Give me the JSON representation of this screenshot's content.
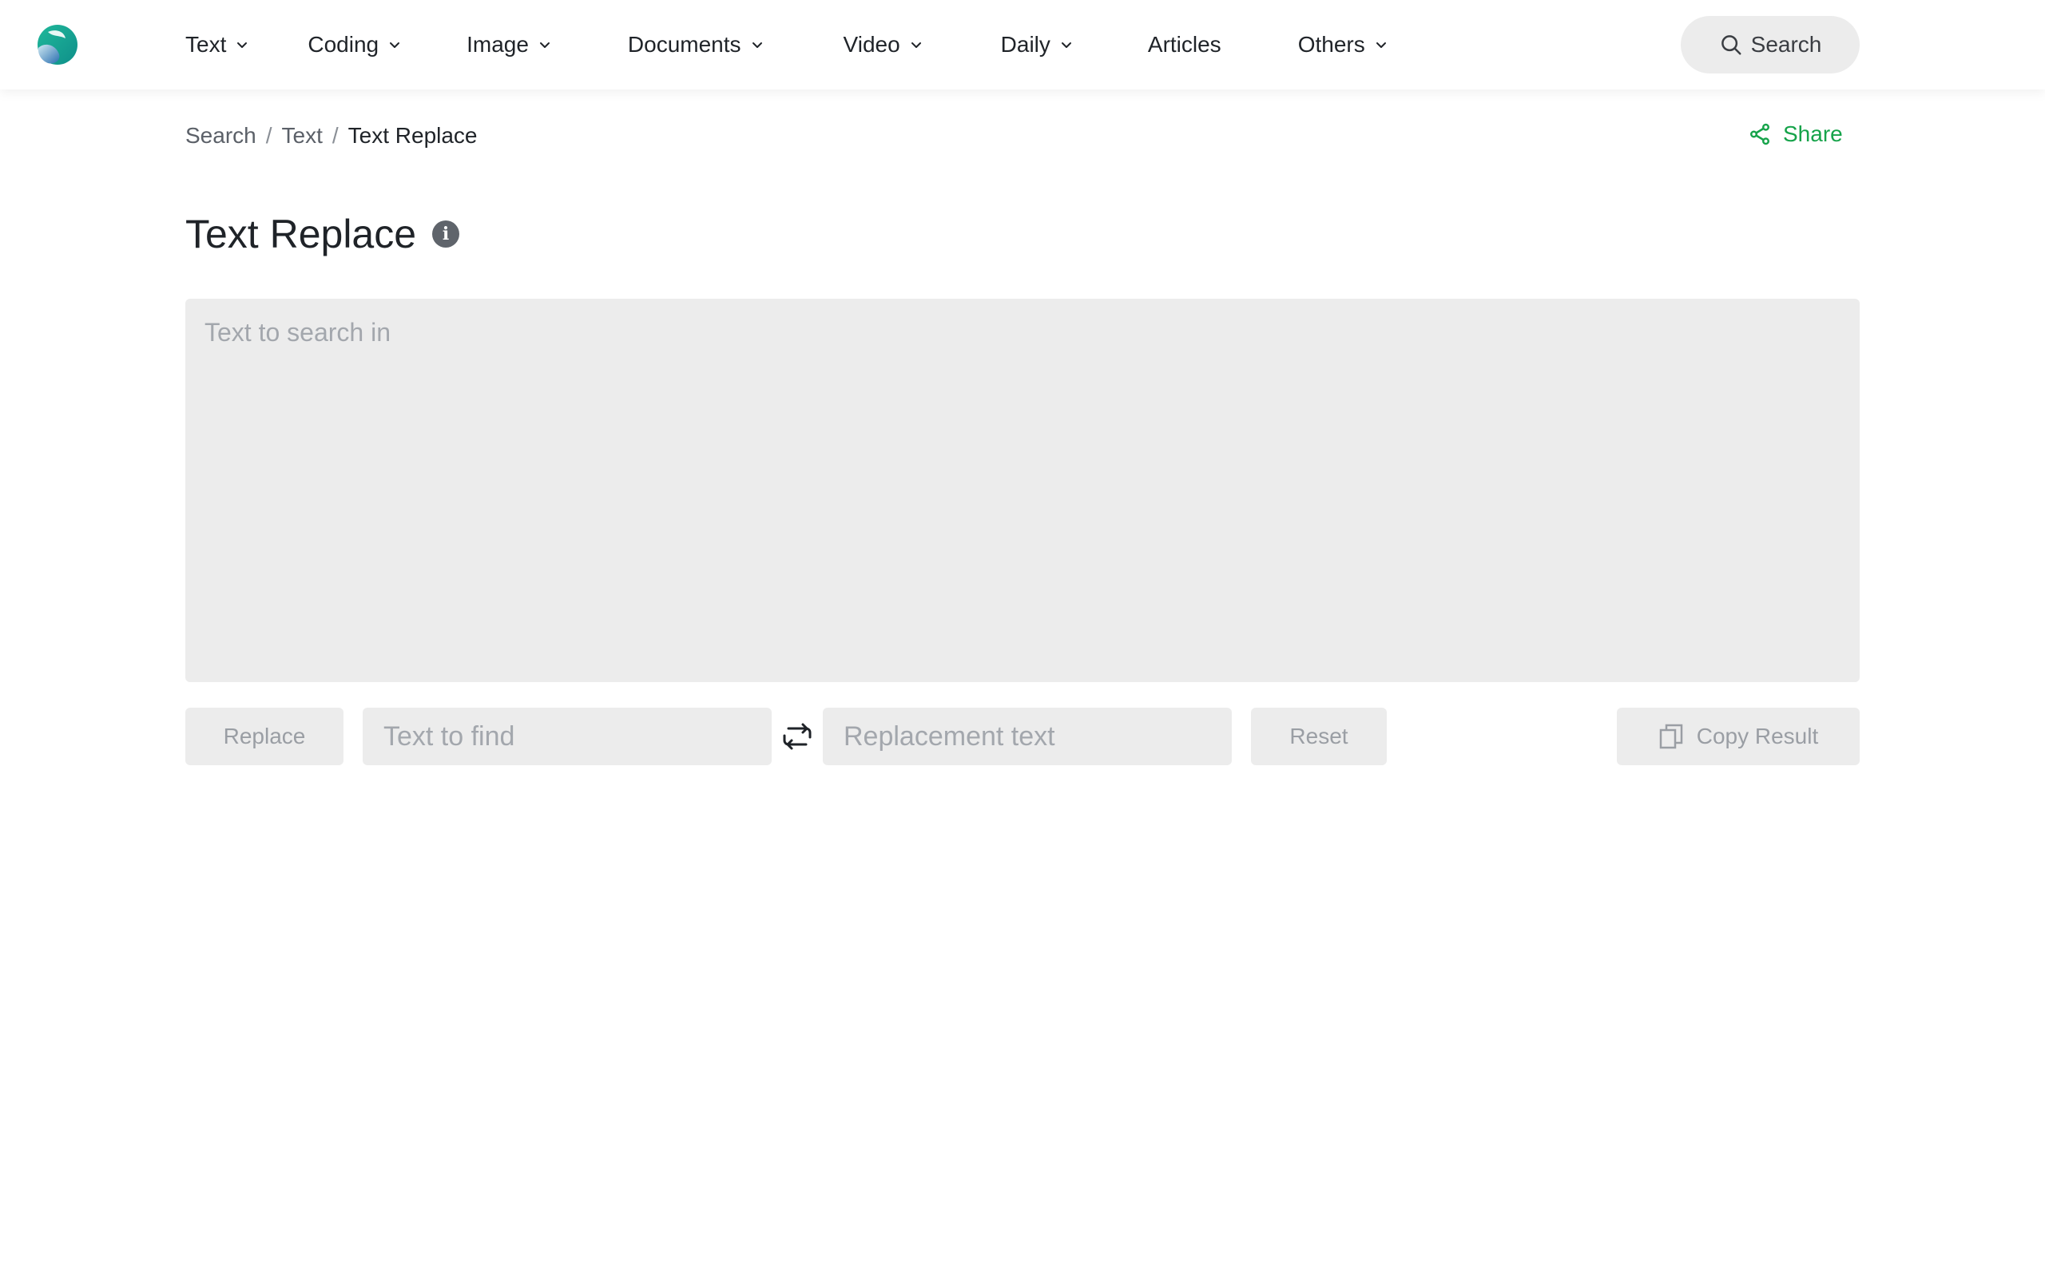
{
  "nav": {
    "items": [
      {
        "label": "Text",
        "has_dropdown": true,
        "active": true
      },
      {
        "label": "Coding",
        "has_dropdown": true,
        "active": false
      },
      {
        "label": "Image",
        "has_dropdown": true,
        "active": false
      },
      {
        "label": "Documents",
        "has_dropdown": true,
        "active": false
      },
      {
        "label": "Video",
        "has_dropdown": true,
        "active": false
      },
      {
        "label": "Daily",
        "has_dropdown": true,
        "active": false
      },
      {
        "label": "Articles",
        "has_dropdown": false,
        "active": false
      },
      {
        "label": "Others",
        "has_dropdown": true,
        "active": false
      }
    ],
    "search_label": "Search"
  },
  "breadcrumb": {
    "items": [
      "Search",
      "Text"
    ],
    "separator": "/",
    "current": "Text Replace"
  },
  "share_label": "Share",
  "page": {
    "title": "Text Replace",
    "info_icon": "i"
  },
  "editor": {
    "value": "",
    "placeholder": "Text to search in"
  },
  "controls": {
    "replace_label": "Replace",
    "find": {
      "value": "",
      "placeholder": "Text to find"
    },
    "replacement": {
      "value": "",
      "placeholder": "Replacement text"
    },
    "reset_label": "Reset",
    "copy_label": "Copy Result"
  },
  "colors": {
    "accent": "#16a34a",
    "field_bg": "#ececec",
    "muted_text": "#9a9ea4",
    "placeholder": "#a3a7ad",
    "logo_teal": "#13a89e",
    "logo_blue": "#2b6fb0"
  },
  "icons": {
    "logo": "brand-logo-icon",
    "chevron": "chevron-down-icon",
    "search": "search-icon",
    "share": "share-icon",
    "info": "info-icon",
    "swap": "swap-icon",
    "copy": "copy-icon"
  }
}
